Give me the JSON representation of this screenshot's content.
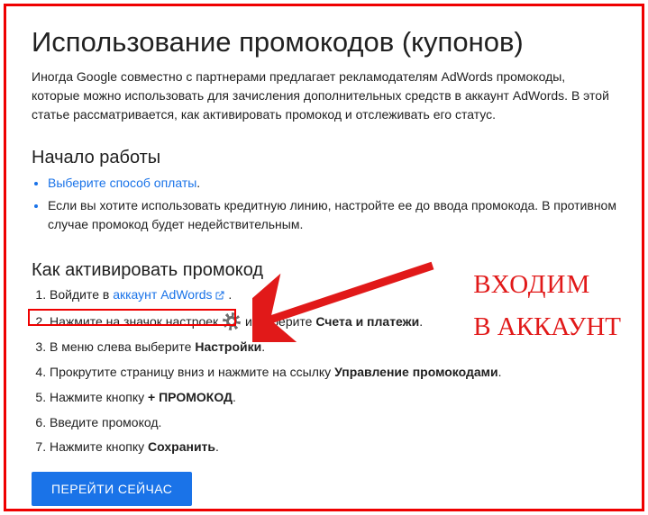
{
  "title": "Использование промокодов (купонов)",
  "intro": "Иногда Google совместно с партнерами предлагает рекламодателям AdWords промокоды, которые можно использовать для зачисления дополнительных средств в аккаунт AdWords. В этой статье рассматривается, как активировать промокод и отслеживать его статус.",
  "section_start": {
    "heading": "Начало работы",
    "bullet1_link": "Выберите способ оплаты",
    "bullet1_dot": ".",
    "bullet2": "Если вы хотите использовать кредитную линию, настройте ее до ввода промокода. В противном случае промокод будет недействительным."
  },
  "section_activate": {
    "heading": "Как активировать промокод",
    "step1_pre": "Войдите в ",
    "step1_link": "аккаунт AdWords",
    "step1_post": " .",
    "step2_pre": "Нажмите на значок настроек ",
    "step2_mid": " и выберите ",
    "step2_bold": "Счета и платежи",
    "step2_post": ".",
    "step3_pre": "В меню слева выберите ",
    "step3_bold": "Настройки",
    "step3_post": ".",
    "step4_pre": "Прокрутите страницу вниз и нажмите на ссылку ",
    "step4_bold": "Управление промокодами",
    "step4_post": ".",
    "step5_pre": "Нажмите кнопку ",
    "step5_bold": "+ ПРОМОКОД",
    "step5_post": ".",
    "step6": "Введите промокод.",
    "step7_pre": "Нажмите кнопку ",
    "step7_bold": "Сохранить",
    "step7_post": "."
  },
  "cta_label": "ПЕРЕЙТИ СЕЙЧАС",
  "annotation": {
    "line1": "ВХОДИМ",
    "line2": "В АККАУНТ"
  }
}
